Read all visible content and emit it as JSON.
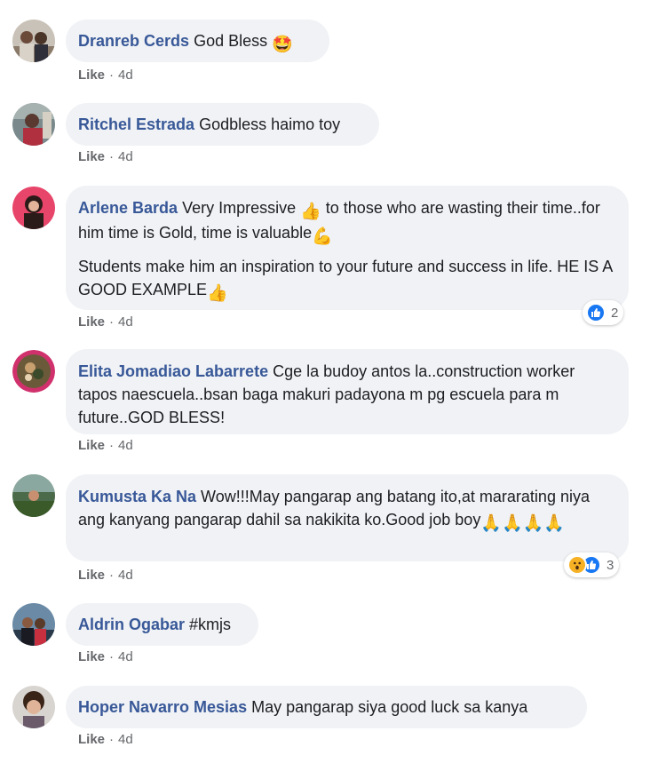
{
  "comments": [
    {
      "author": "Dranreb Cerds",
      "text": "God Bless",
      "emoji": "🤩",
      "like": "Like",
      "age": "4d"
    },
    {
      "author": "Ritchel Estrada",
      "text": "Godbless haimo toy",
      "like": "Like",
      "age": "4d"
    },
    {
      "author": "Arlene Barda",
      "text_a": "Very Impressive ",
      "emoji_a": "👍",
      "text_b": " to those who are wasting their time..for him time is Gold, time is valuable",
      "emoji_b": "💪",
      "text2": "Students make him an inspiration to your future and success in life. HE IS A GOOD EXAMPLE",
      "emoji_c": "👍",
      "like": "Like",
      "age": "4d",
      "reactions": "2"
    },
    {
      "author": "Elita Jomadiao Labarrete",
      "text": "Cge la budoy antos la..construction worker tapos naescuela..bsan baga makuri padayona m pg escuela para m future..GOD BLESS!",
      "like": "Like",
      "age": "4d"
    },
    {
      "author": "Kumusta Ka Na",
      "text": "Wow!!!May pangarap ang batang ito,at mararating niya ang kanyang pangarap dahil sa nakikita ko.Good job boy",
      "emoji": "🙏🙏🙏🙏",
      "like": "Like",
      "age": "4d",
      "reactions": "3"
    },
    {
      "author": "Aldrin Ogabar",
      "text": "#kmjs",
      "like": "Like",
      "age": "4d"
    },
    {
      "author": "Hoper Navarro Mesias",
      "text": "May pangarap siya good luck sa kanya",
      "like": "Like",
      "age": "4d"
    }
  ],
  "colors": {
    "author": "#385898",
    "bubble": "#f0f2f5",
    "meta": "#65676b",
    "like_reaction": "#1877f2",
    "wow_reaction": "#f7b125"
  }
}
